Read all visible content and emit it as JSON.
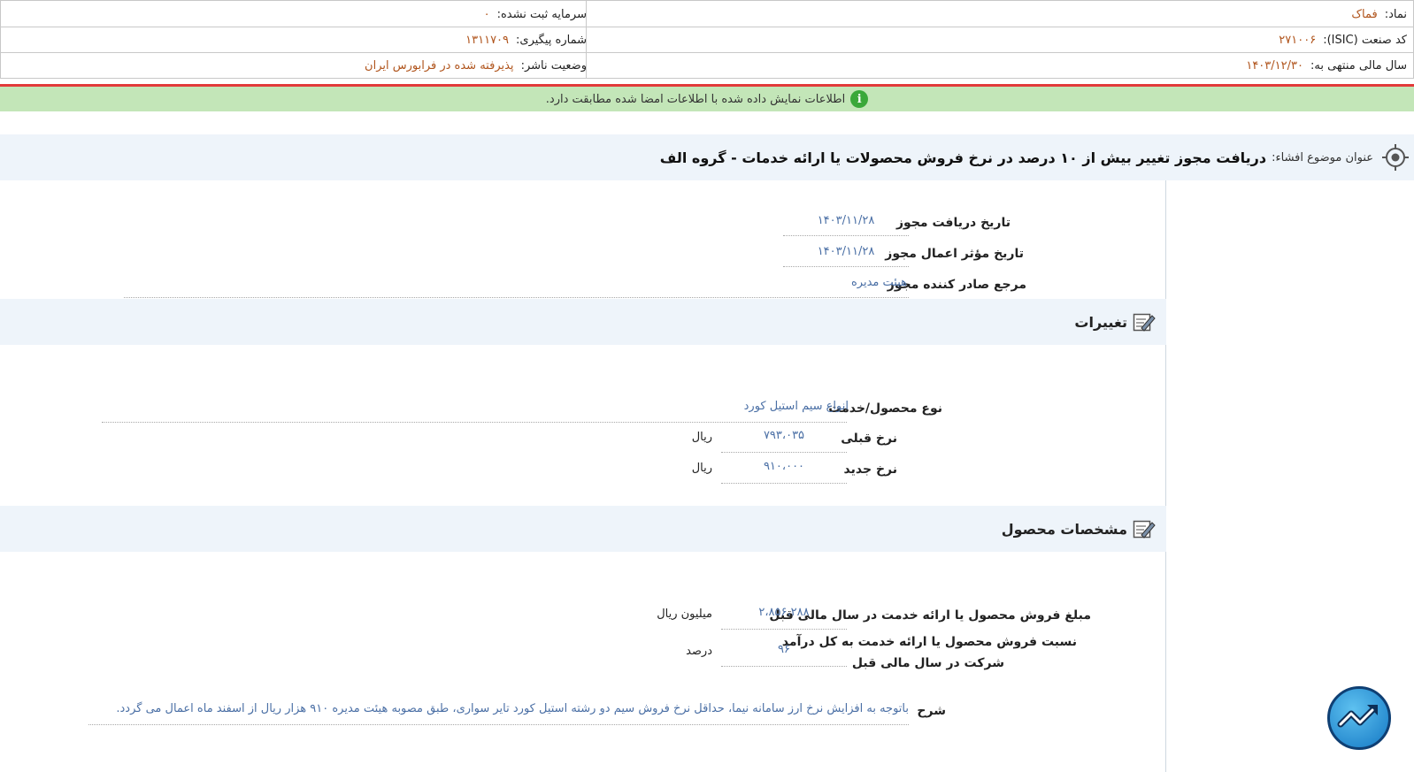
{
  "header": {
    "symbol_label": "نماد:",
    "symbol_value": "فماک",
    "capital_label": "سرمایه ثبت نشده:",
    "capital_value": "۰",
    "isic_label": "کد صنعت (ISIC):",
    "isic_value": "۲۷۱۰۰۶",
    "tracking_label": "شماره پیگیری:",
    "tracking_value": "۱۳۱۱۷۰۹",
    "fiscal_label": "سال مالی منتهی به:",
    "fiscal_value": "۱۴۰۳/۱۲/۳۰",
    "publisher_label": "وضعیت ناشر:",
    "publisher_value": "پذیرفته شده در فرابورس ایران"
  },
  "notice": {
    "icon": "info-icon",
    "text": "اطلاعات نمایش داده شده با اطلاعات امضا شده مطابقت دارد."
  },
  "disclosure": {
    "icon": "target-icon",
    "label": "عنوان موضوع افشاء:",
    "title": "دریافت مجوز تغییر بیش از ۱۰ درصد در نرخ فروش محصولات یا ارائه خدمات - گروه الف"
  },
  "permit": {
    "received_date_label": "تاریخ دریافت مجوز",
    "received_date_value": "۱۴۰۳/۱۱/۲۸",
    "effective_date_label": "تاریخ مؤثر اعمال مجوز",
    "effective_date_value": "۱۴۰۳/۱۱/۲۸",
    "issuer_label": "مرجع صادر کننده مجوز",
    "issuer_value": "هیئت مدیره"
  },
  "changes": {
    "icon": "edit-icon",
    "title": "تغییرات",
    "product_label": "نوع محصول/خدمت",
    "product_value": "انواع سیم استیل کورد",
    "prev_rate_label": "نرخ قبلی",
    "prev_rate_value": "۷۹۳،۰۳۵",
    "prev_rate_unit": "ریال",
    "new_rate_label": "نرخ جدید",
    "new_rate_value": "۹۱۰،۰۰۰",
    "new_rate_unit": "ریال"
  },
  "product_specs": {
    "icon": "edit-icon",
    "title": "مشخصات محصول",
    "sales_label": "مبلغ فروش محصول یا ارائه خدمت در سال مالی قبل",
    "sales_value": "۲،۸۵۶،۲۸۸",
    "sales_unit": "میلیون ریال",
    "ratio_label_1": "نسبت فروش محصول یا ارائه خدمت به کل درآمد",
    "ratio_label_2": "شرکت در سال مالی قبل",
    "ratio_value": "۹۶",
    "ratio_unit": "درصد",
    "desc_label": "شرح",
    "desc_value": "باتوجه به افزایش نرخ ارز سامانه نیما، حداقل نرخ فروش سیم دو رشته استیل کورد تایر سواری، طبق مصوبه هیئت مدیره ۹۱۰ هزار ریال از اسفند ماه اعمال می گردد."
  },
  "logo": {
    "icon": "chart-logo-icon"
  }
}
